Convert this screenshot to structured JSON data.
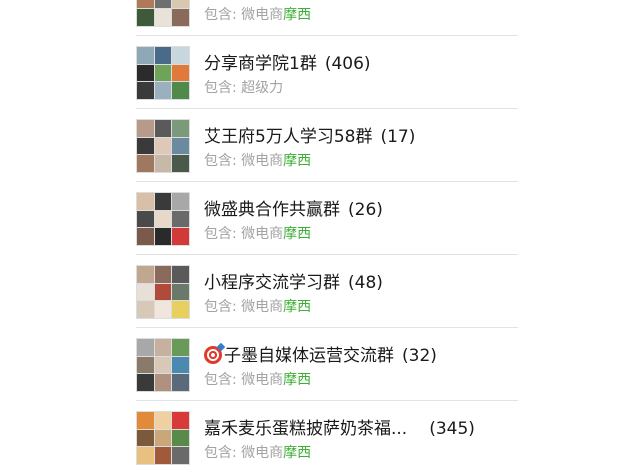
{
  "groups": [
    {
      "title": "",
      "count": "",
      "prefix": "包含: ",
      "sub_plain": "微电商",
      "sub_highlight": "摩西"
    },
    {
      "title": "分享商学院1群",
      "count": "(406)",
      "prefix": "包含: ",
      "sub_plain": "超级力",
      "sub_highlight": ""
    },
    {
      "title": "艾王府5万人学习58群",
      "count": "(17)",
      "prefix": "包含: ",
      "sub_plain": "微电商",
      "sub_highlight": "摩西"
    },
    {
      "title": "微盛典合作共赢群",
      "count": "(26)",
      "prefix": "包含: ",
      "sub_plain": "微电商",
      "sub_highlight": "摩西"
    },
    {
      "title": "小程序交流学习群",
      "count": "(48)",
      "prefix": "包含: ",
      "sub_plain": "微电商",
      "sub_highlight": "摩西"
    },
    {
      "title": "子墨自媒体运营交流群",
      "count": "(32)",
      "prefix": "包含: ",
      "sub_plain": "微电商",
      "sub_highlight": "摩西",
      "emoji": "target-emoji"
    },
    {
      "title": "嘉禾麦乐蛋糕披萨奶茶福...",
      "count": "(345)",
      "prefix": "包含: ",
      "sub_plain": "微电商",
      "sub_highlight": "摩西"
    }
  ],
  "colors": {
    "highlight": "#3cb034",
    "subtext": "#a3a3a3",
    "title": "#1a1a1a",
    "divider": "#e3e3e3"
  }
}
